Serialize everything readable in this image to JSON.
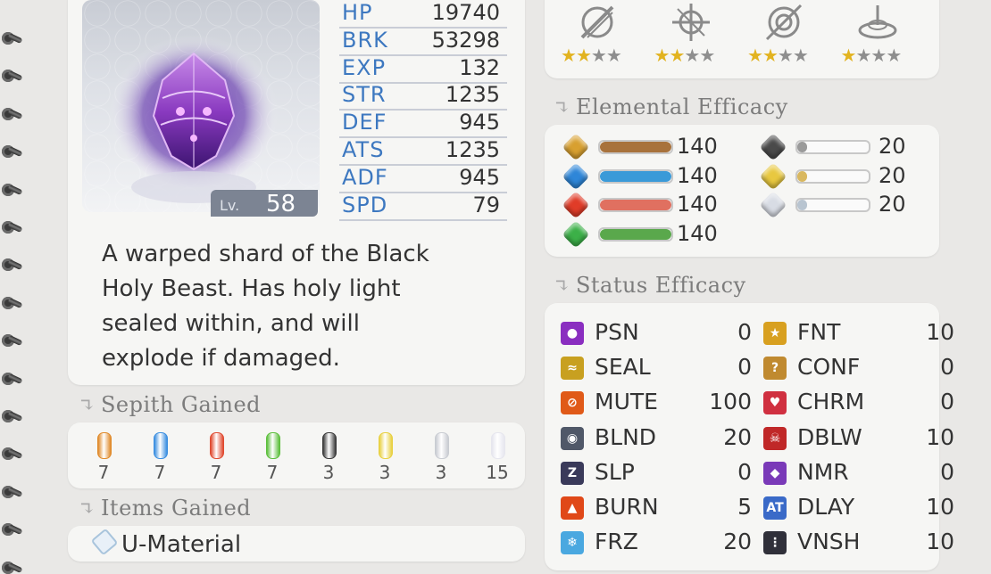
{
  "monster": {
    "level_label": "Lv.",
    "level": "58",
    "description_lines": [
      "A warped shard of the Black",
      "Holy Beast. Has holy light",
      "sealed within, and will",
      "explode if damaged."
    ]
  },
  "stats": [
    {
      "key": "HP",
      "value": "19740"
    },
    {
      "key": "BRK",
      "value": "53298"
    },
    {
      "key": "EXP",
      "value": "132"
    },
    {
      "key": "STR",
      "value": "1235"
    },
    {
      "key": "DEF",
      "value": "945"
    },
    {
      "key": "ATS",
      "value": "1235"
    },
    {
      "key": "ADF",
      "value": "945"
    },
    {
      "key": "SPD",
      "value": "79"
    }
  ],
  "sepith": {
    "title": "Sepith Gained",
    "items": [
      {
        "color": "#e08a2a",
        "value": "7"
      },
      {
        "color": "#3a8ee0",
        "value": "7"
      },
      {
        "color": "#e04a30",
        "value": "7"
      },
      {
        "color": "#5cbf3c",
        "value": "7"
      },
      {
        "color": "#3a3a3a",
        "value": "3"
      },
      {
        "color": "#e8d040",
        "value": "3"
      },
      {
        "color": "#c9ccd2",
        "value": "3"
      },
      {
        "color": "#e6e6ee",
        "value": "15"
      }
    ]
  },
  "items_gained": {
    "title": "Items Gained",
    "first_item": "U-Material"
  },
  "unbalance": [
    {
      "icon": "slash-icon",
      "stars_on": 2,
      "stars_total": 4
    },
    {
      "icon": "thrust-icon",
      "stars_on": 2,
      "stars_total": 4
    },
    {
      "icon": "pierce-icon",
      "stars_on": 2,
      "stars_total": 4
    },
    {
      "icon": "strike-icon",
      "stars_on": 1,
      "stars_total": 4
    }
  ],
  "elemental": {
    "title": "Elemental Efficacy",
    "left": [
      {
        "element": "earth",
        "gem_color": "#d8a030",
        "bar_color": "#a8723c",
        "value": "140",
        "level": 1.0
      },
      {
        "element": "water",
        "gem_color": "#2e86d8",
        "bar_color": "#3a9ad8",
        "value": "140",
        "level": 1.0
      },
      {
        "element": "fire",
        "gem_color": "#e03c28",
        "bar_color": "#e07060",
        "value": "140",
        "level": 1.0
      },
      {
        "element": "wind",
        "gem_color": "#3cb048",
        "bar_color": "#5aa84c",
        "value": "140",
        "level": 1.0
      }
    ],
    "right": [
      {
        "element": "time",
        "gem_color": "#4a4a4a",
        "bar_color": "#9a9a9a",
        "value": "20",
        "level": 0.14
      },
      {
        "element": "space",
        "gem_color": "#e8c840",
        "bar_color": "#d9b860",
        "value": "20",
        "level": 0.14
      },
      {
        "element": "mirage",
        "gem_color": "#d8dce4",
        "bar_color": "#b8c4d0",
        "value": "20",
        "level": 0.14
      }
    ]
  },
  "status": {
    "title": "Status Efficacy",
    "left": [
      {
        "name": "PSN",
        "value": "0",
        "icon": "poison-icon",
        "icon_color": "#8a2ec0"
      },
      {
        "name": "SEAL",
        "value": "0",
        "icon": "seal-icon",
        "icon_color": "#c8a020"
      },
      {
        "name": "MUTE",
        "value": "100",
        "icon": "mute-icon",
        "icon_color": "#e05a18"
      },
      {
        "name": "BLND",
        "value": "20",
        "icon": "blind-icon",
        "icon_color": "#505868"
      },
      {
        "name": "SLP",
        "value": "0",
        "icon": "sleep-icon",
        "icon_color": "#3a3a5a"
      },
      {
        "name": "BURN",
        "value": "5",
        "icon": "burn-icon",
        "icon_color": "#e04818"
      },
      {
        "name": "FRZ",
        "value": "20",
        "icon": "freeze-icon",
        "icon_color": "#4aa8e0"
      }
    ],
    "right": [
      {
        "name": "FNT",
        "value": "10",
        "icon": "faint-icon",
        "icon_color": "#d8a020"
      },
      {
        "name": "CONF",
        "value": "0",
        "icon": "confuse-icon",
        "icon_color": "#c08a30"
      },
      {
        "name": "CHRM",
        "value": "0",
        "icon": "charm-icon",
        "icon_color": "#d03040"
      },
      {
        "name": "DBLW",
        "value": "10",
        "icon": "deathblow-icon",
        "icon_color": "#c02828"
      },
      {
        "name": "NMR",
        "value": "0",
        "icon": "nightmare-icon",
        "icon_color": "#7a3ab8"
      },
      {
        "name": "DLAY",
        "value": "10",
        "icon": "delay-icon",
        "icon_color": "#3a6ac8"
      },
      {
        "name": "VNSH",
        "value": "10",
        "icon": "vanish-icon",
        "icon_color": "#30303a"
      }
    ]
  }
}
